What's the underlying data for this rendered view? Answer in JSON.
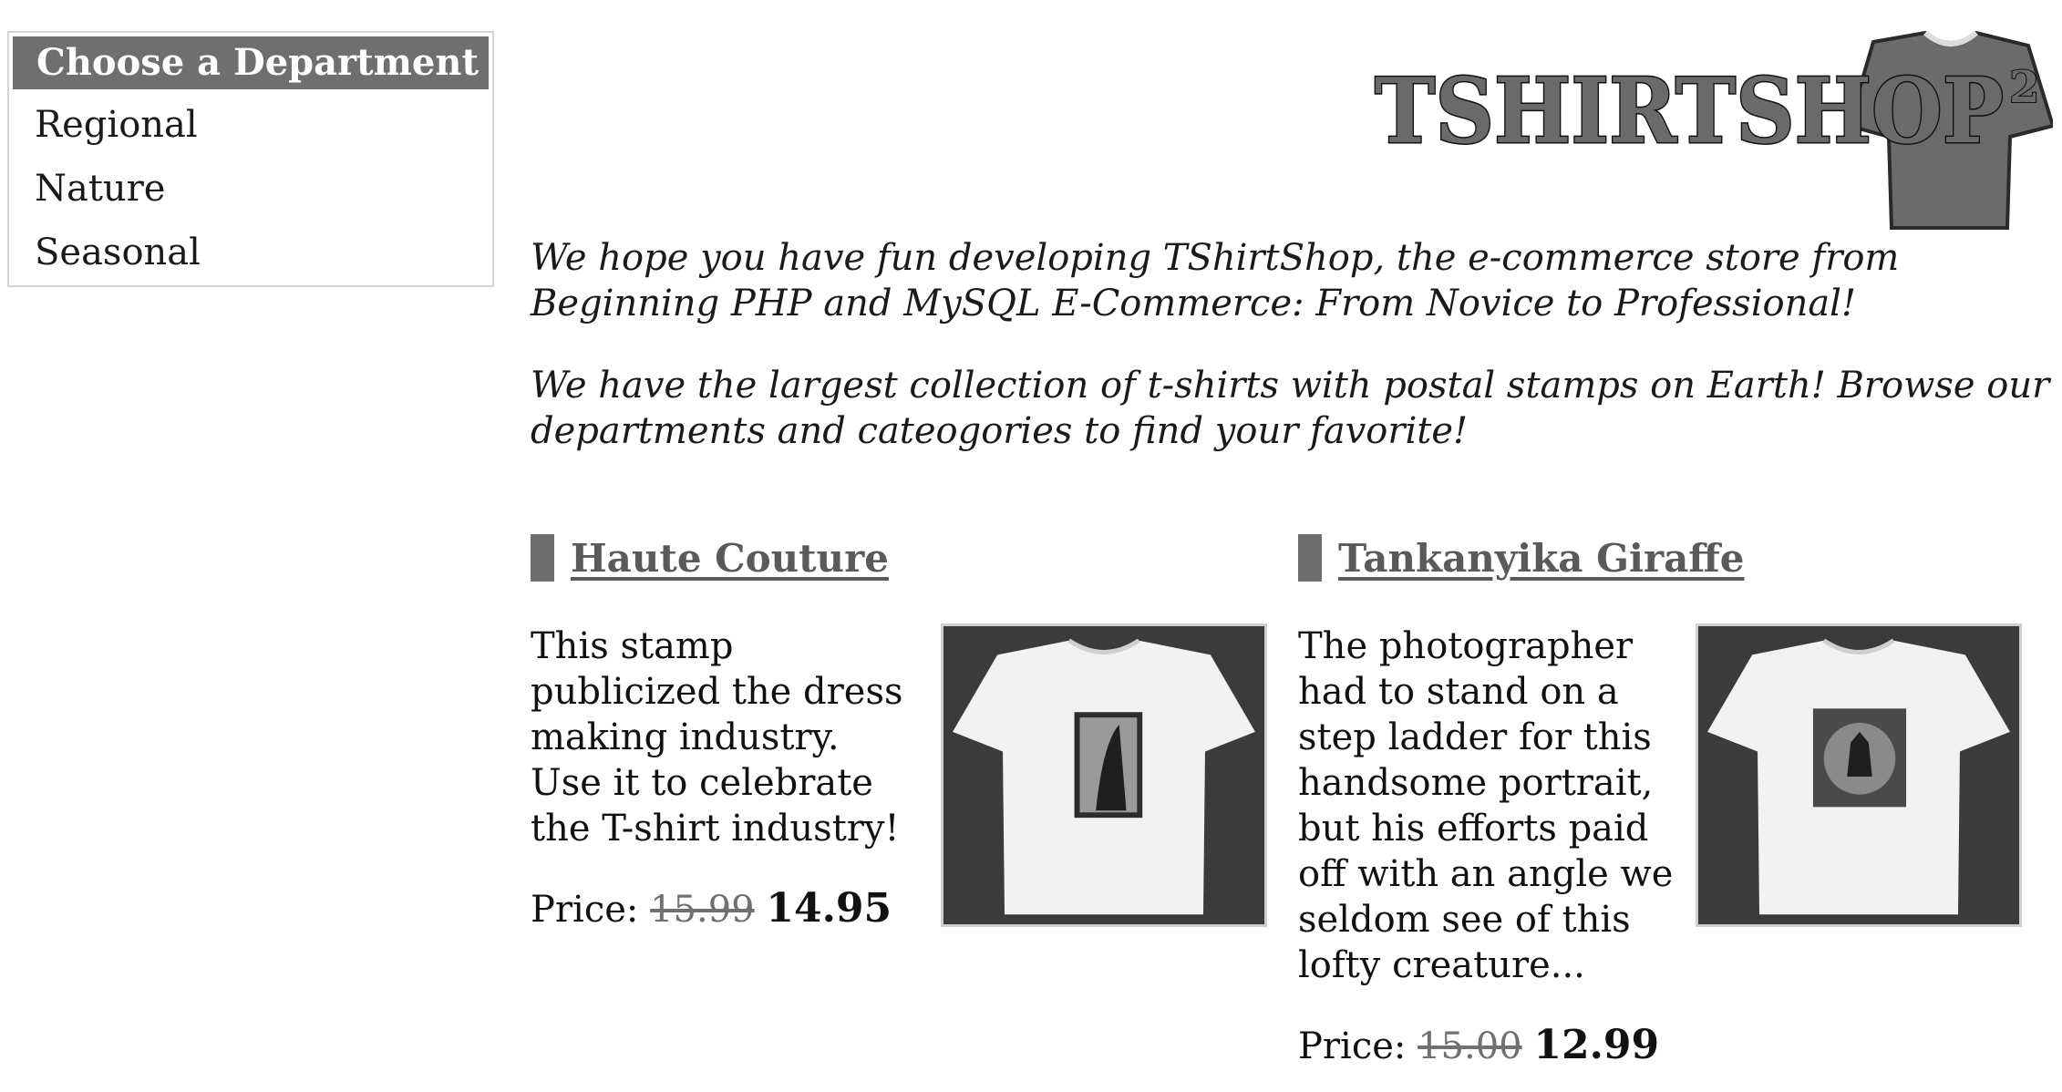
{
  "departments": {
    "header": "Choose a Department",
    "items": [
      {
        "label": "Regional"
      },
      {
        "label": "Nature"
      },
      {
        "label": "Seasonal"
      }
    ]
  },
  "logo": {
    "text": "TSHIRTSHOP",
    "superscript": "2",
    "icon": "tshirt-icon"
  },
  "intro": {
    "paragraph1": "We hope you have fun developing TShirtShop, the e-commerce store from Beginning PHP and MySQL E-Commerce: From Novice to Professional!",
    "paragraph2": "We have the largest collection of t-shirts with postal stamps on Earth! Browse our departments and cateogories to find your favorite!"
  },
  "products": [
    {
      "name": "Haute Couture",
      "description": "This stamp publicized the dress making industry. Use it to celebrate the T-shirt industry!",
      "price_label": "Price:",
      "old_price": "15.99",
      "new_price": "14.95",
      "image_icon": "tshirt-stamp-image"
    },
    {
      "name": "Tankanyika Giraffe",
      "description": "The photographer had to stand on a step ladder for this handsome portrait, but his efforts paid off with an angle we seldom see of this lofty creature...",
      "price_label": "Price:",
      "old_price": "15.00",
      "new_price": "12.99",
      "image_icon": "tshirt-stamp-image"
    }
  ],
  "colors": {
    "header_bg": "#6f6f6f",
    "link": "#5a5a5a",
    "accent_bar": "#6e6e6e"
  }
}
